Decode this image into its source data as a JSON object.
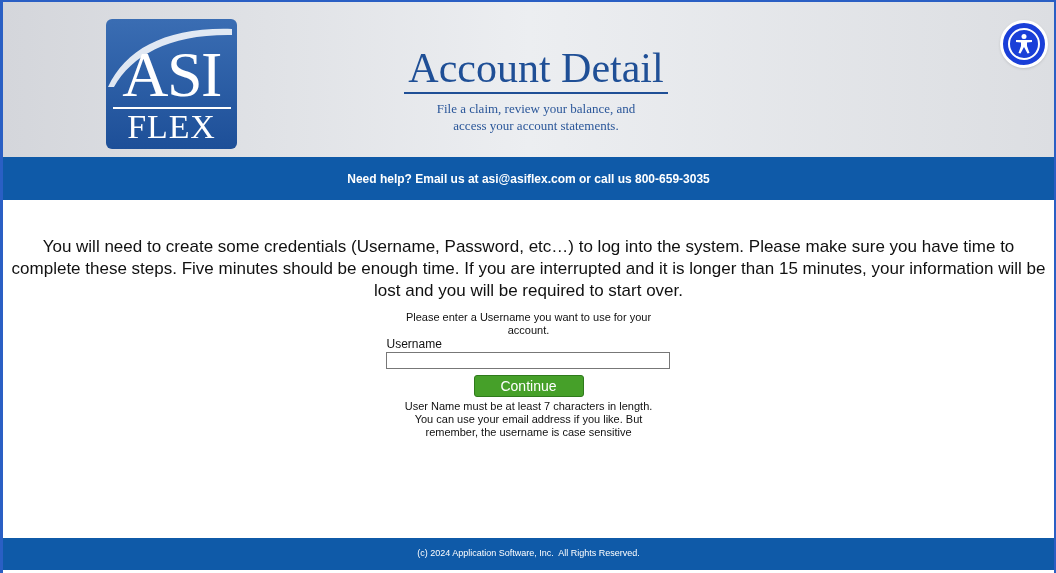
{
  "header": {
    "logo": {
      "line_1": "ASI",
      "line_2": "FLEX"
    },
    "title": "Account Detail",
    "subtitle_lines": [
      "File a claim, review your balance, and",
      "access your account statements."
    ]
  },
  "help_bar": "Need help? Email us at asi@asiflex.com or call us 800-659-3035",
  "intro": "You will need to create some credentials (Username, Password, etc…) to log into the system. Please make sure you have time to complete these steps. Five minutes should be enough time. If you are interrupted and it is longer than 15 minutes, your information will be lost and you will be required to start over.",
  "form": {
    "prompt": "Please enter a Username you want to use for your account.",
    "field_label": "Username",
    "button": "Continue",
    "note": "User Name must be at least 7 characters in length. You can use your email address if you like. But remember, the username is case sensitive"
  },
  "footer": "(c) 2024 Application Software, Inc.  All Rights Reserved."
}
